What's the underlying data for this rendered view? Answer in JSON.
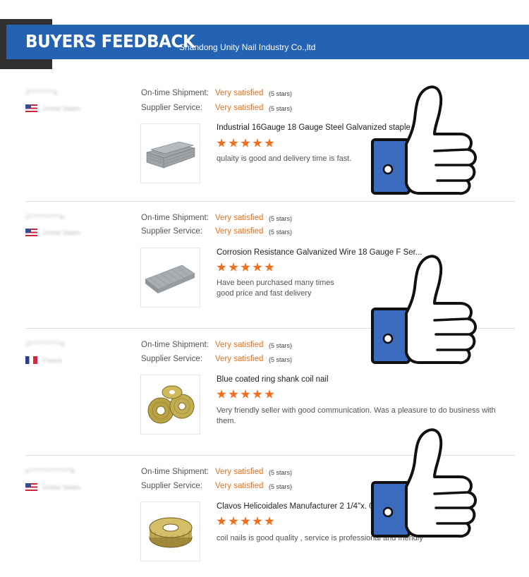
{
  "header": {
    "title": "BUYERS FEEDBACK",
    "subtitle": "Shandong Unity Nail Industry Co.,ltd"
  },
  "labels": {
    "shipment": "On-time Shipment:",
    "service": "Supplier Service:"
  },
  "feedbacks": [
    {
      "buyer": "J*******s",
      "country": "United States",
      "flag": "us",
      "shipment_rating": "Very satisfied",
      "shipment_stars": "(5 stars)",
      "service_rating": "Very satisfied",
      "service_stars": "(5 stars)",
      "product_title": "Industrial 16Gauge 18 Gauge Steel Galvanized staple ...",
      "product_image": "staples-icon",
      "comment": "qulaity is good and delivery time is fast."
    },
    {
      "buyer": "J*********e",
      "country": "United States",
      "flag": "us",
      "shipment_rating": "Very satisfied",
      "shipment_stars": "(5 stars)",
      "service_rating": "Very satisfied",
      "service_stars": "(5 stars)",
      "product_title": "Corrosion Resistance Galvanized Wire 18 Gauge F Ser...",
      "product_image": "brad-nails-icon",
      "comment": "Have been purchased many times\ngood price and fast delivery"
    },
    {
      "buyer": "J*********e",
      "country": "France",
      "flag": "fr",
      "shipment_rating": "Very satisfied",
      "shipment_stars": "(5 stars)",
      "service_rating": "Very satisfied",
      "service_stars": "(5 stars)",
      "product_title": "Blue coated ring shank coil nail",
      "product_image": "coil-nails-icon",
      "comment": "Very friendly seller with good communication. Was a pleasure to do business with them."
    },
    {
      "buyer": "s************k",
      "country": "United States",
      "flag": "us",
      "shipment_rating": "Very satisfied",
      "shipment_stars": "(5 stars)",
      "service_rating": "Very satisfied",
      "service_stars": "(5 stars)",
      "product_title": "Clavos Helicoidales Manufacturer 2 1/4\"x. 099\" Wire...",
      "product_image": "coil-nail-icon",
      "comment": "coil nails is good quality , service is professional and friendly"
    }
  ],
  "colors": {
    "banner": "#2462b4",
    "rating_text": "#e8711f",
    "star": "#f56d1a",
    "thumb_cuff": "#3a6bbf"
  }
}
